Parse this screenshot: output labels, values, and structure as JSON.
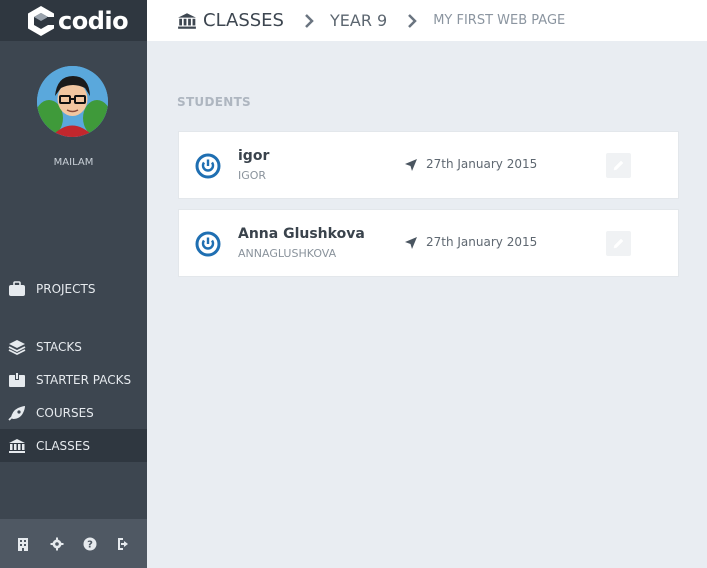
{
  "app": {
    "logo_text": "codio"
  },
  "sidebar": {
    "username": "MAILAM",
    "nav": [
      {
        "label": "PROJECTS",
        "icon": "briefcase-icon"
      },
      {
        "label": "STACKS",
        "icon": "layers-icon"
      },
      {
        "label": "STARTER PACKS",
        "icon": "box-icon"
      },
      {
        "label": "COURSES",
        "icon": "rocket-icon"
      },
      {
        "label": "CLASSES",
        "icon": "institution-icon",
        "active": true
      }
    ],
    "footer_icons": [
      "building-icon",
      "gear-icon",
      "help-icon",
      "logout-icon"
    ]
  },
  "breadcrumb": {
    "items": [
      "CLASSES",
      "YEAR 9",
      "MY FIRST WEB PAGE"
    ]
  },
  "students": {
    "title": "STUDENTS",
    "items": [
      {
        "name": "igor",
        "username": "IGOR",
        "date": "27th January 2015"
      },
      {
        "name": "Anna Glushkova",
        "username": "ANNAGLUSHKOVA",
        "date": "27th January 2015"
      }
    ]
  },
  "colors": {
    "sidebar_bg": "#3d4650",
    "sidebar_dark": "#2f3740",
    "main_bg": "#e9edf2",
    "accent_blue": "#1f6fb2"
  }
}
